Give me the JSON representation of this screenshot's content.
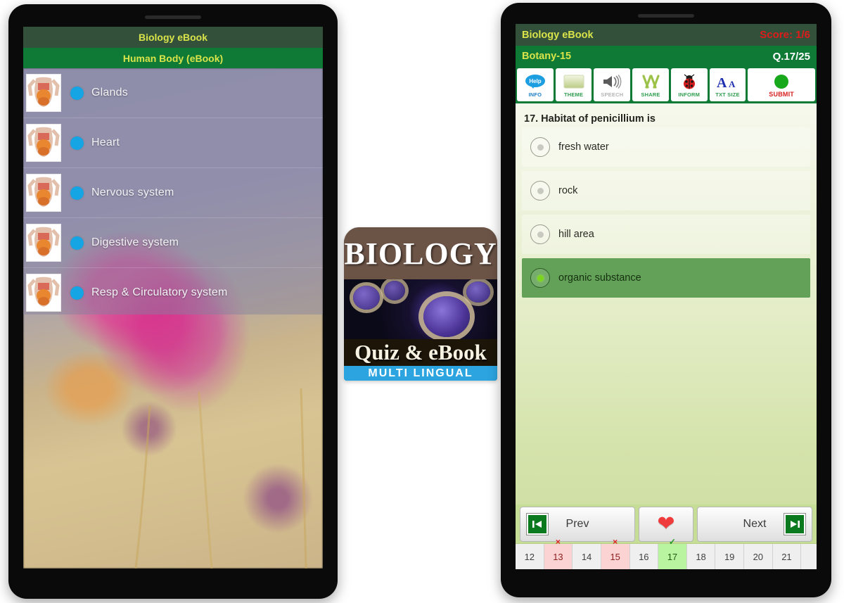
{
  "left_phone": {
    "title": "Biology eBook",
    "subtitle": "Human Body (eBook)",
    "items": [
      {
        "label": "Glands"
      },
      {
        "label": "Heart"
      },
      {
        "label": "Nervous system"
      },
      {
        "label": "Digestive system"
      },
      {
        "label": "Resp & Circulatory system"
      }
    ]
  },
  "logo": {
    "title": "BIOLOGY",
    "subtitle": "Quiz & eBook",
    "tagline": "MULTI LINGUAL"
  },
  "right_phone": {
    "app_title": "Biology eBook",
    "score": "Score: 1/6",
    "category": "Botany-15",
    "question_counter": "Q.17/25",
    "toolbar": [
      {
        "icon": "info-icon",
        "label": "INFO",
        "state": "blue"
      },
      {
        "icon": "theme-icon",
        "label": "THEME",
        "state": "green"
      },
      {
        "icon": "speech-icon",
        "label": "SPEECH",
        "state": "grey"
      },
      {
        "icon": "share-icon",
        "label": "SHARE",
        "state": "green"
      },
      {
        "icon": "inform-icon",
        "label": "INFORM",
        "state": "green"
      },
      {
        "icon": "txtsize-icon",
        "label": "TXT SIZE",
        "state": "green"
      },
      {
        "icon": "submit-icon",
        "label": "SUBMIT",
        "state": "red"
      }
    ],
    "question": "17. Habitat of penicillium is",
    "options": [
      {
        "label": "fresh water",
        "selected": false
      },
      {
        "label": "rock",
        "selected": false
      },
      {
        "label": "hill area",
        "selected": false
      },
      {
        "label": "organic substance",
        "selected": true
      }
    ],
    "nav": {
      "prev_label": "Prev",
      "next_label": "Next",
      "favorite_icon": "heart-icon",
      "first_icon": "skip-first-icon",
      "last_icon": "skip-last-icon"
    },
    "question_strip": [
      {
        "num": "12",
        "state": "none"
      },
      {
        "num": "13",
        "state": "wrong",
        "mark": "×"
      },
      {
        "num": "14",
        "state": "none"
      },
      {
        "num": "15",
        "state": "wrong",
        "mark": "×"
      },
      {
        "num": "16",
        "state": "none"
      },
      {
        "num": "17",
        "state": "right",
        "mark": "✓"
      },
      {
        "num": "18",
        "state": "none"
      },
      {
        "num": "19",
        "state": "none"
      },
      {
        "num": "20",
        "state": "none"
      },
      {
        "num": "21",
        "state": "none"
      }
    ]
  },
  "colors": {
    "header_dark_green": "#33503a",
    "header_green": "#0e7a36",
    "accent_yellow": "#d9e34a",
    "score_red": "#e01b1b",
    "selected_option": "#63a158",
    "list_dot_blue": "#15a5e4"
  }
}
